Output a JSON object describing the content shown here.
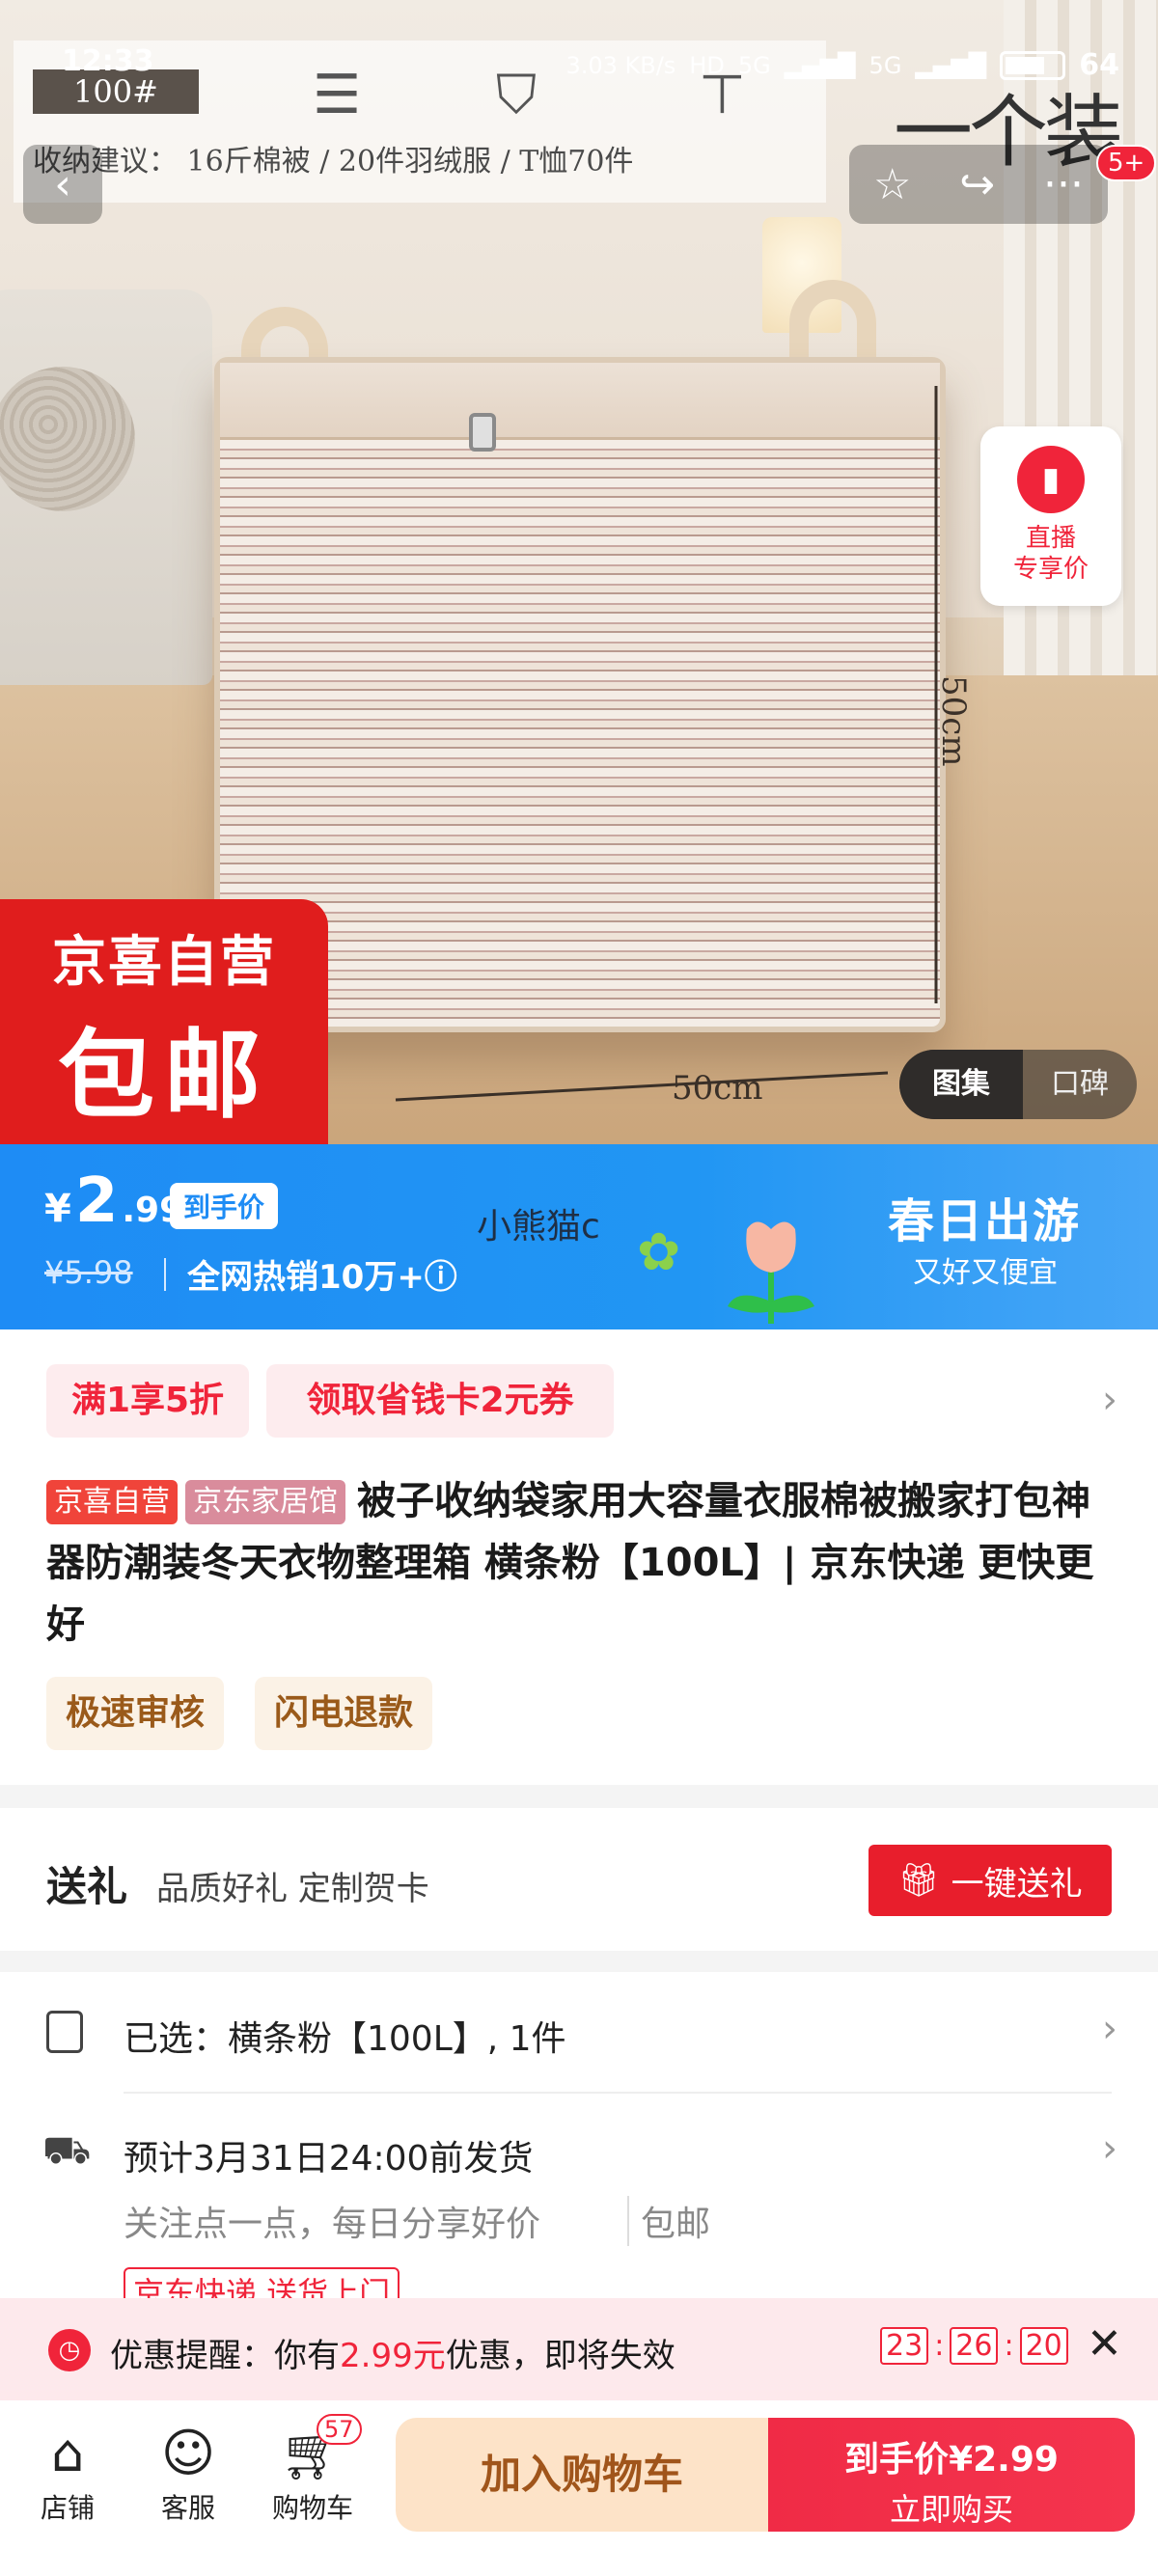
{
  "status_bar": {
    "time": "12:33",
    "speed": "3.03 KB/s",
    "hd": "HD",
    "net1": "5G",
    "net2": "5G",
    "battery": "64"
  },
  "tip_card": {
    "tag": "100#",
    "text": "收纳建议：  16斤棉被  /  20件羽绒服  /  T恤70件"
  },
  "hero": {
    "brand_overlay": "一个装",
    "width_label": "50cm",
    "height_label": "50cm"
  },
  "nav": {
    "back_icon": "chevron-left-icon",
    "fav_icon": "star-icon",
    "share_icon": "share-icon",
    "more_icon": "more-icon",
    "badge": "5+"
  },
  "live": {
    "line1": "直播",
    "line2": "专享价"
  },
  "promo_badge": {
    "line1": "京喜自营",
    "line2": "包邮"
  },
  "gallery_toggle": {
    "active": "图集",
    "inactive": "口碑"
  },
  "price_band": {
    "currency": "¥",
    "price_int": "2",
    "price_dec": ".99",
    "tag": "到手价",
    "old_price": "¥5.98",
    "hot": "全网热销10万+ⓘ",
    "user": "小熊猫c",
    "campaign": "春日出游",
    "campaign_sub": "又好又便宜"
  },
  "coupons": [
    "满1享5折",
    "领取省钱卡2元券"
  ],
  "product": {
    "tag1": "京喜自营",
    "tag2": "京东家居馆",
    "title": "被子收纳袋家用大容量衣服棉被搬家打包神器防潮装冬天衣物整理箱 横条粉【100L】| 京东快递 更快更好"
  },
  "services": [
    "极速审核",
    "闪电退款"
  ],
  "gift": {
    "title": "送礼",
    "desc": "品质好礼 定制贺卡",
    "button": "一键送礼"
  },
  "selected": {
    "text": "已选：横条粉【100L】, 1件"
  },
  "delivery": {
    "line1": "预计3月31日24:00前发货",
    "line2": "关注点一点，每日分享好价",
    "line2b": "包邮",
    "line3": "京东快递 送货上门"
  },
  "alert": {
    "prefix": "优惠提醒：你有",
    "amount": "2.99元",
    "suffix": "优惠，即将失效",
    "h": "23",
    "m": "26",
    "s": "20"
  },
  "tabbar": {
    "shop": "店铺",
    "service": "客服",
    "cart": "购物车",
    "cart_count": "57",
    "add_cart": "加入购物车",
    "buy_top_prefix": "到手价",
    "buy_price": "¥2.99",
    "buy_bottom": "立即购买"
  },
  "colors": {
    "accent": "#f0243a",
    "blue": "#1e8cf5"
  }
}
